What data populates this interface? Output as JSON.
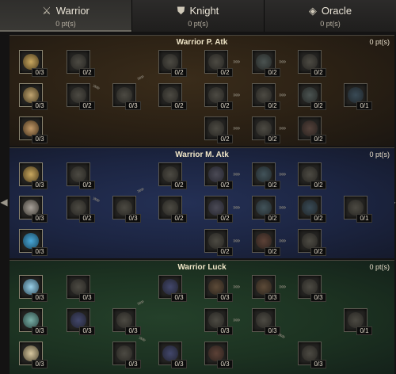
{
  "tabs": [
    {
      "label": "Warrior",
      "points": "0 pt(s)",
      "icon": "crossed-swords-icon",
      "active": true
    },
    {
      "label": "Knight",
      "points": "0 pt(s)",
      "icon": "shield-icon",
      "active": false
    },
    {
      "label": "Oracle",
      "points": "0 pt(s)",
      "icon": "eye-icon",
      "active": false
    }
  ],
  "sections": {
    "patk": {
      "title": "Warrior P. Atk",
      "points": "0 pt(s)",
      "row1": [
        "0/3",
        "0/2",
        "0/2",
        "0/2",
        "0/2",
        "0/2"
      ],
      "row2": [
        "0/3",
        "0/2",
        "0/3",
        "0/2",
        "0/2",
        "0/2",
        "0/2",
        "0/1"
      ],
      "row3": [
        "0/3",
        "0/2",
        "0/2",
        "0/2"
      ]
    },
    "matk": {
      "title": "Warrior M. Atk",
      "points": "0 pt(s)",
      "row1": [
        "0/3",
        "0/2",
        "0/2",
        "0/2",
        "0/2",
        "0/2"
      ],
      "row2": [
        "0/3",
        "0/2",
        "0/3",
        "0/2",
        "0/2",
        "0/2",
        "0/2",
        "0/1"
      ],
      "row3": [
        "0/3",
        "0/2",
        "0/2",
        "0/2"
      ]
    },
    "luck": {
      "title": "Warrior Luck",
      "points": "0 pt(s)",
      "row1": [
        "0/3",
        "0/3",
        "0/3",
        "0/3",
        "0/3",
        "0/3"
      ],
      "row2": [
        "0/3",
        "0/3",
        "0/3",
        "0/3",
        "0/3",
        "0/1"
      ],
      "row3": [
        "0/3",
        "0/3",
        "0/3",
        "0/3",
        "0/3"
      ]
    }
  },
  "colors": {
    "patk_bg": "#2a2014",
    "matk_bg": "#1c2542",
    "luck_bg": "#1c3221",
    "title_text": "#f0e6c8"
  },
  "icons": {
    "left_arrow": "chevron-left-icon",
    "right_arrow": "chevron-right-icon",
    "connector": "arrow-chain-icon"
  }
}
